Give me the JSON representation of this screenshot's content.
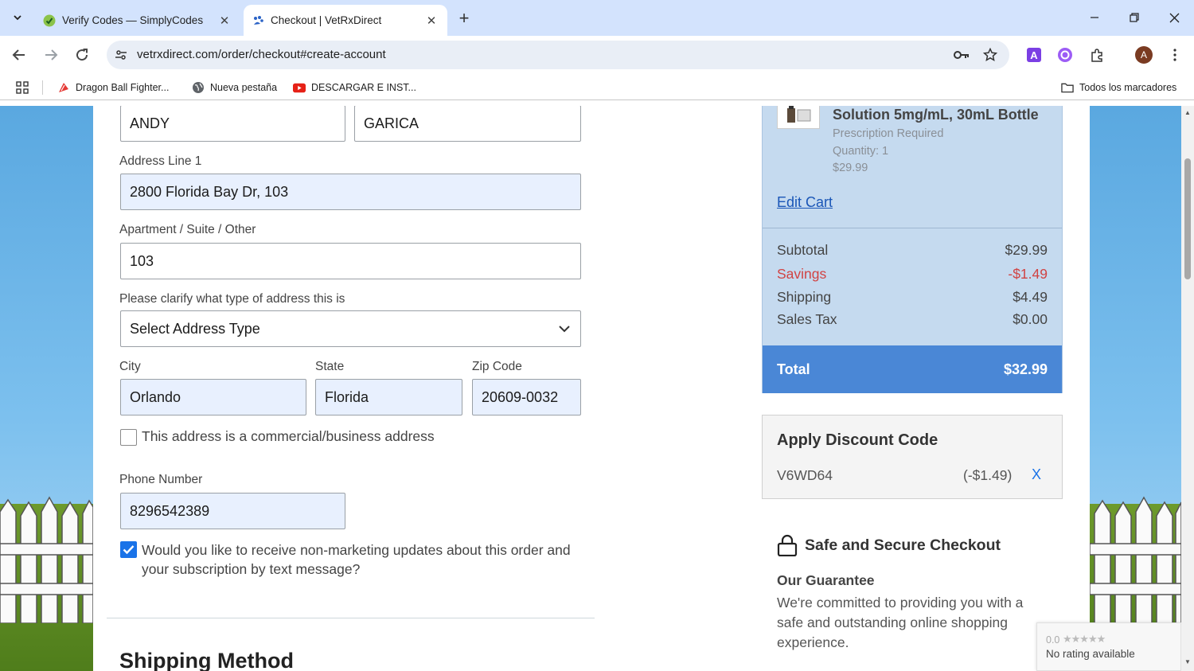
{
  "browser": {
    "tabs": [
      {
        "title": "Verify Codes — SimplyCodes",
        "active": false
      },
      {
        "title": "Checkout | VetRxDirect",
        "active": true
      }
    ],
    "url": "vetrxdirect.com/order/checkout#create-account",
    "bookmarks": [
      {
        "label": "Dragon Ball Fighter..."
      },
      {
        "label": "Nueva pestaña"
      },
      {
        "label": "DESCARGAR E INST..."
      }
    ],
    "all_bookmarks_label": "Todos los marcadores",
    "profile_initial": "A",
    "colors": {
      "tabbar": "#d3e3fd",
      "omnibox": "#e9eef6"
    }
  },
  "form": {
    "first_name": "ANDY",
    "last_name": "GARICA",
    "address1_label": "Address Line 1",
    "address1_value": "2800 Florida Bay Dr, 103",
    "apt_label": "Apartment / Suite / Other",
    "apt_value": "103",
    "address_type_label": "Please clarify what type of address this is",
    "address_type_value": "Select Address Type",
    "city_label": "City",
    "city_value": "Orlando",
    "state_label": "State",
    "state_value": "Florida",
    "zip_label": "Zip Code",
    "zip_value": "20609-0032",
    "commercial_label": "This address is a commercial/business address",
    "commercial_checked": false,
    "phone_label": "Phone Number",
    "phone_value": "8296542389",
    "sms_label_line1": "Would you like to receive non-marketing updates about this order and",
    "sms_label_line2": "your subscription by text message?",
    "sms_checked": true,
    "shipping_method_title": "Shipping Method"
  },
  "summary": {
    "product_name": "Solution 5mg/mL, 30mL Bottle",
    "prescription": "Prescription Required",
    "quantity": "Quantity: 1",
    "price": "$29.99",
    "edit_cart": "Edit Cart",
    "subtotal_label": "Subtotal",
    "subtotal_value": "$29.99",
    "savings_label": "Savings",
    "savings_value": "-$1.49",
    "shipping_label": "Shipping",
    "shipping_value": "$4.49",
    "tax_label": "Sales Tax",
    "tax_value": "$0.00",
    "total_label": "Total",
    "total_value": "$32.99",
    "colors": {
      "panel": "#c5daef",
      "total_bar": "#4a87d6",
      "savings": "#d14343"
    }
  },
  "discount": {
    "title": "Apply Discount Code",
    "code": "V6WD64",
    "amount": "(-$1.49)",
    "remove": "X"
  },
  "secure": {
    "title": "Safe and Secure Checkout",
    "guarantee_title": "Our Guarantee",
    "guarantee_text": "We're committed to providing you with a safe and outstanding online shopping experience."
  },
  "rating": {
    "score": "0.0",
    "stars": "★★★★★",
    "text": "No rating available"
  }
}
